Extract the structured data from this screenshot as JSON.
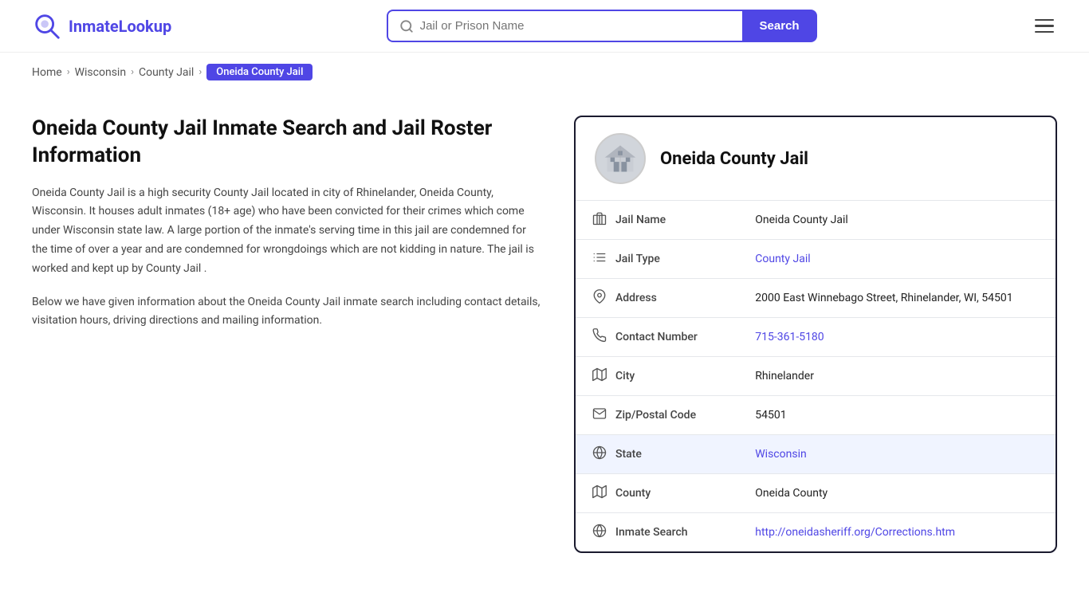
{
  "header": {
    "logo_text_part1": "Inmate",
    "logo_text_part2": "Lookup",
    "search_placeholder": "Jail or Prison Name",
    "search_button_label": "Search"
  },
  "breadcrumb": {
    "items": [
      {
        "label": "Home",
        "href": "#",
        "active": false
      },
      {
        "label": "Wisconsin",
        "href": "#",
        "active": false
      },
      {
        "label": "County Jail",
        "href": "#",
        "active": false
      },
      {
        "label": "Oneida County Jail",
        "href": "#",
        "active": true
      }
    ]
  },
  "left": {
    "page_title": "Oneida County Jail Inmate Search and Jail Roster Information",
    "description1": "Oneida County Jail is a high security County Jail located in city of Rhinelander, Oneida County, Wisconsin. It houses adult inmates (18+ age) who have been convicted for their crimes which come under Wisconsin state law. A large portion of the inmate's serving time in this jail are condemned for the time of over a year and are condemned for wrongdoings which are not kidding in nature. The jail is worked and kept up by County Jail .",
    "description2": "Below we have given information about the Oneida County Jail inmate search including contact details, visitation hours, driving directions and mailing information."
  },
  "card": {
    "title": "Oneida County Jail",
    "rows": [
      {
        "id": "jail-name",
        "icon": "building-icon",
        "label": "Jail Name",
        "value": "Oneida County Jail",
        "link": false,
        "highlighted": false
      },
      {
        "id": "jail-type",
        "icon": "list-icon",
        "label": "Jail Type",
        "value": "County Jail",
        "link": true,
        "href": "#",
        "highlighted": false
      },
      {
        "id": "address",
        "icon": "pin-icon",
        "label": "Address",
        "value": "2000 East Winnebago Street, Rhinelander, WI, 54501",
        "link": false,
        "highlighted": false
      },
      {
        "id": "contact",
        "icon": "phone-icon",
        "label": "Contact Number",
        "value": "715-361-5180",
        "link": true,
        "href": "tel:7153615180",
        "highlighted": false
      },
      {
        "id": "city",
        "icon": "map-icon",
        "label": "City",
        "value": "Rhinelander",
        "link": false,
        "highlighted": false
      },
      {
        "id": "zip",
        "icon": "mail-icon",
        "label": "Zip/Postal Code",
        "value": "54501",
        "link": false,
        "highlighted": false
      },
      {
        "id": "state",
        "icon": "globe-icon",
        "label": "State",
        "value": "Wisconsin",
        "link": true,
        "href": "#",
        "highlighted": true
      },
      {
        "id": "county",
        "icon": "map2-icon",
        "label": "County",
        "value": "Oneida County",
        "link": false,
        "highlighted": false
      },
      {
        "id": "inmate-search",
        "icon": "globe2-icon",
        "label": "Inmate Search",
        "value": "http://oneidasheriff.org/Corrections.htm",
        "link": true,
        "href": "http://oneidasheriff.org/Corrections.htm",
        "highlighted": false
      }
    ]
  }
}
